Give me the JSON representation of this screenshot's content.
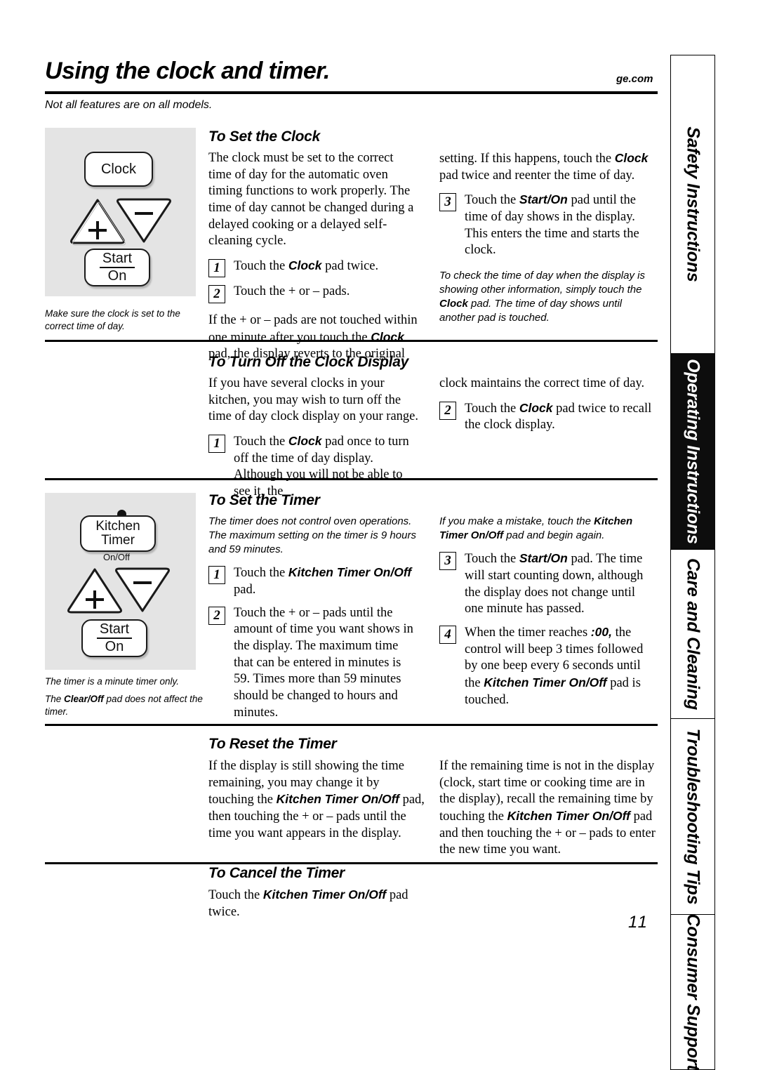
{
  "header": {
    "title": "Using the clock and timer.",
    "url": "ge.com",
    "subtitle": "Not all features are on all models."
  },
  "side_tabs": [
    {
      "label": "Safety Instructions",
      "active": false
    },
    {
      "label": "Operating Instructions",
      "active": true
    },
    {
      "label": "Care and Cleaning",
      "active": false
    },
    {
      "label": "Troubleshooting Tips",
      "active": false
    },
    {
      "label": "Consumer Support",
      "active": false
    }
  ],
  "illustrations": {
    "clock_panel": {
      "pads": {
        "clock": "Clock",
        "plus": "+",
        "minus": "–",
        "start_top": "Start",
        "start_bottom": "On"
      },
      "caption": "Make sure the clock is set to the correct time of day."
    },
    "timer_panel": {
      "pads": {
        "timer_line1": "Kitchen",
        "timer_line2": "Timer",
        "onoff": "On/Off",
        "plus": "+",
        "minus": "–",
        "start_top": "Start",
        "start_bottom": "On"
      },
      "caption_1": "The timer is a minute timer only.",
      "caption_2_pre": "The ",
      "caption_2_bold": "Clear/Off",
      "caption_2_post": " pad does not affect the timer."
    }
  },
  "sections": {
    "set_clock": {
      "heading": "To Set the Clock",
      "intro": "The clock must be set to the correct time of day for the automatic oven timing functions to work properly. The time of day cannot be changed during a delayed cooking or a delayed self-cleaning cycle.",
      "step1_num": "1",
      "step1_pre": "Touch the ",
      "step1_bold": "Clock",
      "step1_post": " pad twice.",
      "step2_num": "2",
      "step2_text": "Touch the + or – pads.",
      "tail_left_pre": "If the + or – pads are not touched within one minute after you touch the ",
      "tail_left_bold": "Clock",
      "tail_left_post": " pad, the display reverts to the original",
      "tail_right_pre": "setting. If this happens, touch the ",
      "tail_right_bold": "Clock",
      "tail_right_post": " pad twice and reenter the time of day.",
      "step3_num": "3",
      "step3_pre": "Touch the ",
      "step3_bold": "Start/On",
      "step3_post": " pad until the time of day shows in the display. This enters the time and starts the clock.",
      "note_pre": "To check the time of day when the display is showing other information, simply touch the ",
      "note_bold": "Clock",
      "note_post": " pad. The time of day shows until another pad is touched."
    },
    "turn_off_clock": {
      "heading": "To Turn Off the Clock Display",
      "intro": "If you have several clocks in your kitchen, you may wish to turn off the time of day clock display on your range.",
      "step1_num": "1",
      "step1_pre": "Touch the ",
      "step1_bold": "Clock",
      "step1_post": " pad once to turn off the time of day display. Although you will not be able to see it, the",
      "right_tail": "clock maintains the correct time of day.",
      "step2_num": "2",
      "step2_pre": "Touch the ",
      "step2_bold": "Clock",
      "step2_post": " pad twice to recall the clock display."
    },
    "set_timer": {
      "heading": "To Set the Timer",
      "note": "The timer does not control oven operations. The maximum setting on the timer is 9 hours and 59 minutes.",
      "step1_num": "1",
      "step1_pre": "Touch the ",
      "step1_bold": "Kitchen Timer On/Off",
      "step1_post": " pad.",
      "step2_num": "2",
      "step2_text": "Touch the + or – pads until the amount of time you want shows in the display. The maximum time that can be entered in minutes is 59. Times more than 59 minutes should be changed to hours and minutes.",
      "right_note_pre": "If you make a mistake, touch the ",
      "right_note_bold": "Kitchen Timer On/Off",
      "right_note_post": " pad and begin again.",
      "step3_num": "3",
      "step3_pre": "Touch the ",
      "step3_bold": "Start/On",
      "step3_post": " pad. The time will start counting down, although the display does not change until one minute has passed.",
      "step4_num": "4",
      "step4_pre": "When the timer reaches ",
      "step4_bold1": ":00,",
      "step4_mid": " the control will beep 3 times followed by one beep every 6 seconds until the ",
      "step4_bold2": "Kitchen Timer On/Off",
      "step4_post": " pad is touched."
    },
    "reset_timer": {
      "heading": "To Reset the Timer",
      "left_pre": "If the display is still showing the time remaining, you may change it by touching the ",
      "left_bold": "Kitchen Timer On/Off",
      "left_post": " pad, then touching the + or – pads until the time you want appears in the display.",
      "right_pre": "If the remaining time is not in the display (clock, start time or cooking time are in the display), recall the remaining time by touching the ",
      "right_bold": "Kitchen Timer On/Off",
      "right_post": " pad and then touching the + or – pads to enter the new time you want."
    },
    "cancel_timer": {
      "heading": "To Cancel the Timer",
      "text_pre": "Touch the ",
      "text_bold": "Kitchen Timer On/Off",
      "text_post": " pad twice."
    }
  },
  "page_number": "11"
}
